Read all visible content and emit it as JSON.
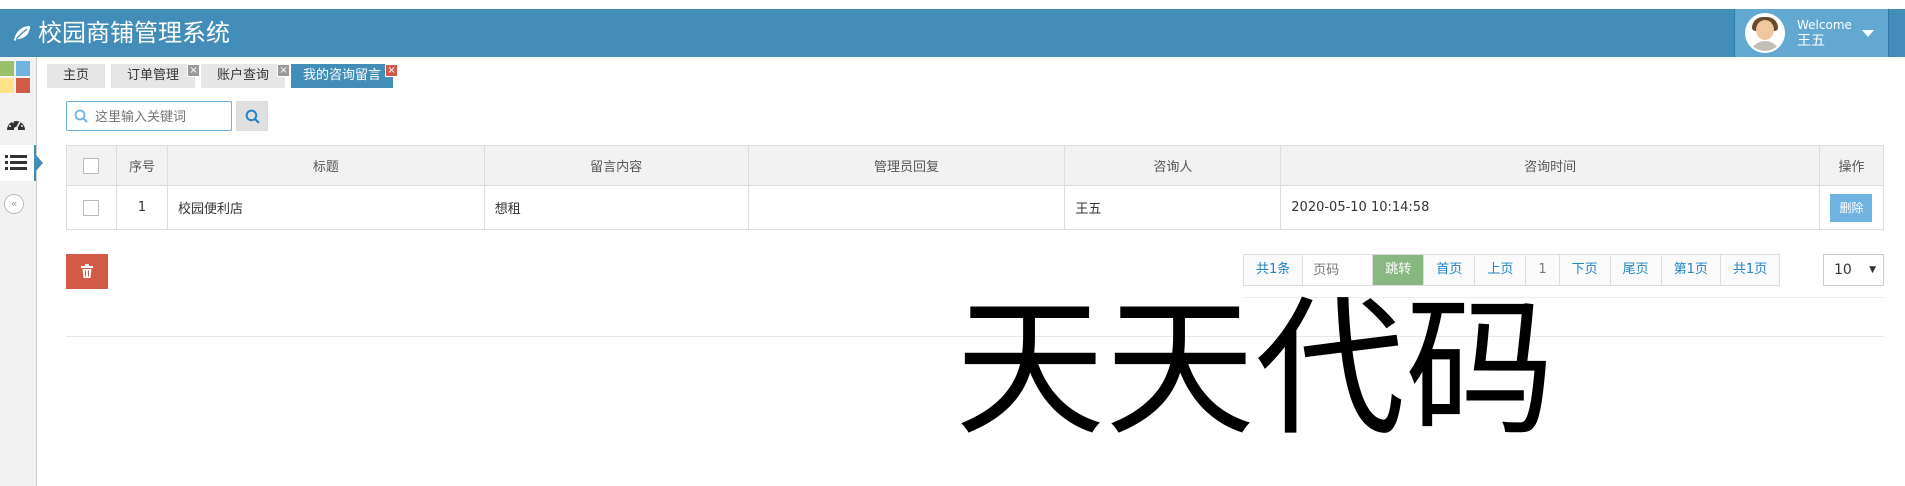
{
  "header": {
    "title": "校园商铺管理系统",
    "welcome": "Welcome",
    "username": "王五"
  },
  "colors": {
    "header": "#438eb9",
    "active_tab": "#438eb9",
    "danger": "#d15b47",
    "success": "#87b87f",
    "info": "#6fb3e0"
  },
  "tabs": [
    {
      "label": "主页",
      "closable": false
    },
    {
      "label": "订单管理",
      "closable": true
    },
    {
      "label": "账户查询",
      "closable": true
    },
    {
      "label": "我的咨询留言",
      "closable": true,
      "active": true
    }
  ],
  "tab_close": "×",
  "search": {
    "placeholder": "这里输入关键词"
  },
  "table": {
    "columns": [
      "序号",
      "标题",
      "留言内容",
      "管理员回复",
      "咨询人",
      "咨询时间",
      "操作"
    ],
    "rows": [
      {
        "index": "1",
        "title": "校园便利店",
        "content": "想租",
        "reply": "",
        "person": "王五",
        "time": "2020-05-10 10:14:58",
        "action": "删除"
      }
    ]
  },
  "pagination": {
    "total": "共1条",
    "page_input_placeholder": "页码",
    "jump": "跳转",
    "first": "首页",
    "prev": "上页",
    "current": "1",
    "next": "下页",
    "last": "尾页",
    "page_info": "第1页",
    "total_pages": "共1页",
    "page_size": "10"
  },
  "collapse_glyph": "«",
  "watermark": "天天代码"
}
